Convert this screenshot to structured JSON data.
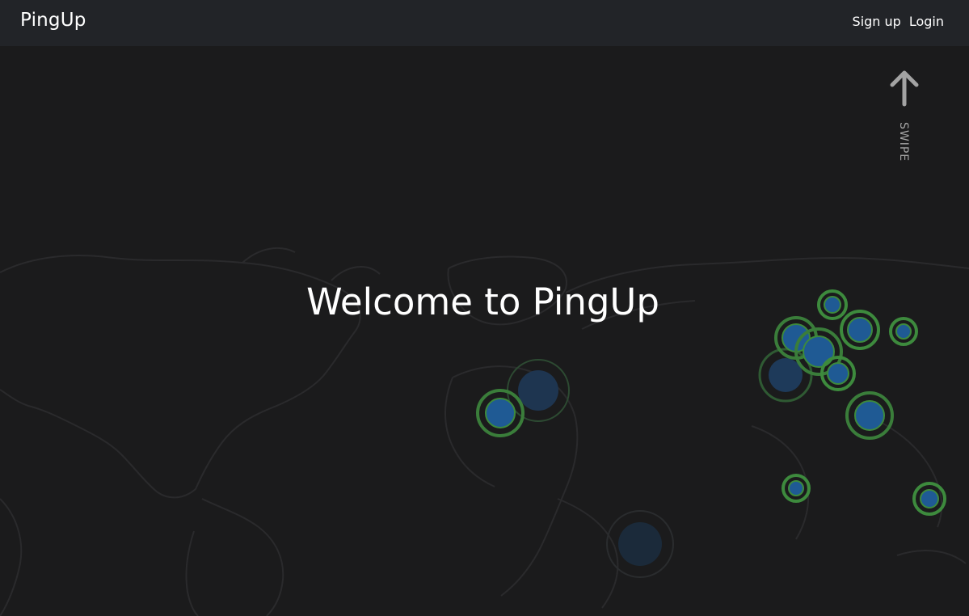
{
  "navbar": {
    "brand": "PingUp",
    "links": [
      {
        "label": "Sign up"
      },
      {
        "label": "Login"
      }
    ]
  },
  "hero": {
    "title": "Welcome to PingUp"
  },
  "swipe": {
    "label": "SWIPE",
    "icon": "arrow-up-icon"
  },
  "colors": {
    "background": "#1b1b1c",
    "navbar": "#222428",
    "ping_fill": "#1f5a94",
    "ping_ring": "#3d8a3d",
    "faded_ping_fill": "#1e3550",
    "map_outline": "#2b2b2d"
  }
}
